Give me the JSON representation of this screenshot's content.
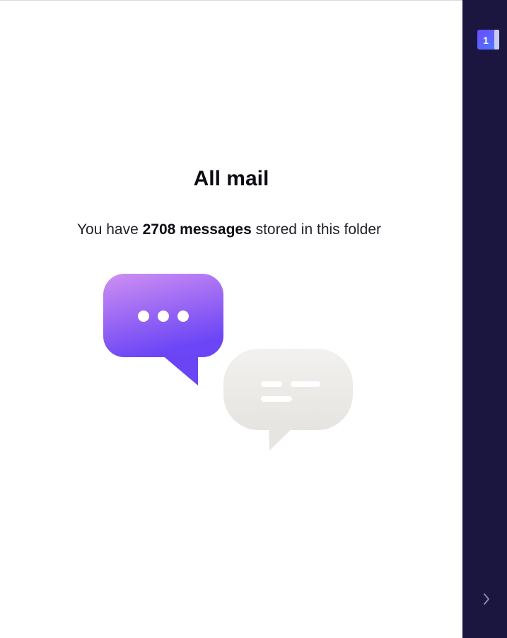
{
  "folder": {
    "title": "All mail",
    "summary_prefix": "You have ",
    "message_count_label": "2708 messages",
    "summary_suffix": " stored in this folder"
  },
  "illustration": {
    "icon": "chat-bubbles-icon",
    "colors": {
      "bubble_purple_top": "#cf8ff2",
      "bubble_purple_bottom": "#6b45f6",
      "bubble_gray": "#ecebe8"
    }
  },
  "sidebar": {
    "calendar_badge": "1",
    "expand_icon": "chevron-right-icon",
    "background": "#1b1640"
  }
}
